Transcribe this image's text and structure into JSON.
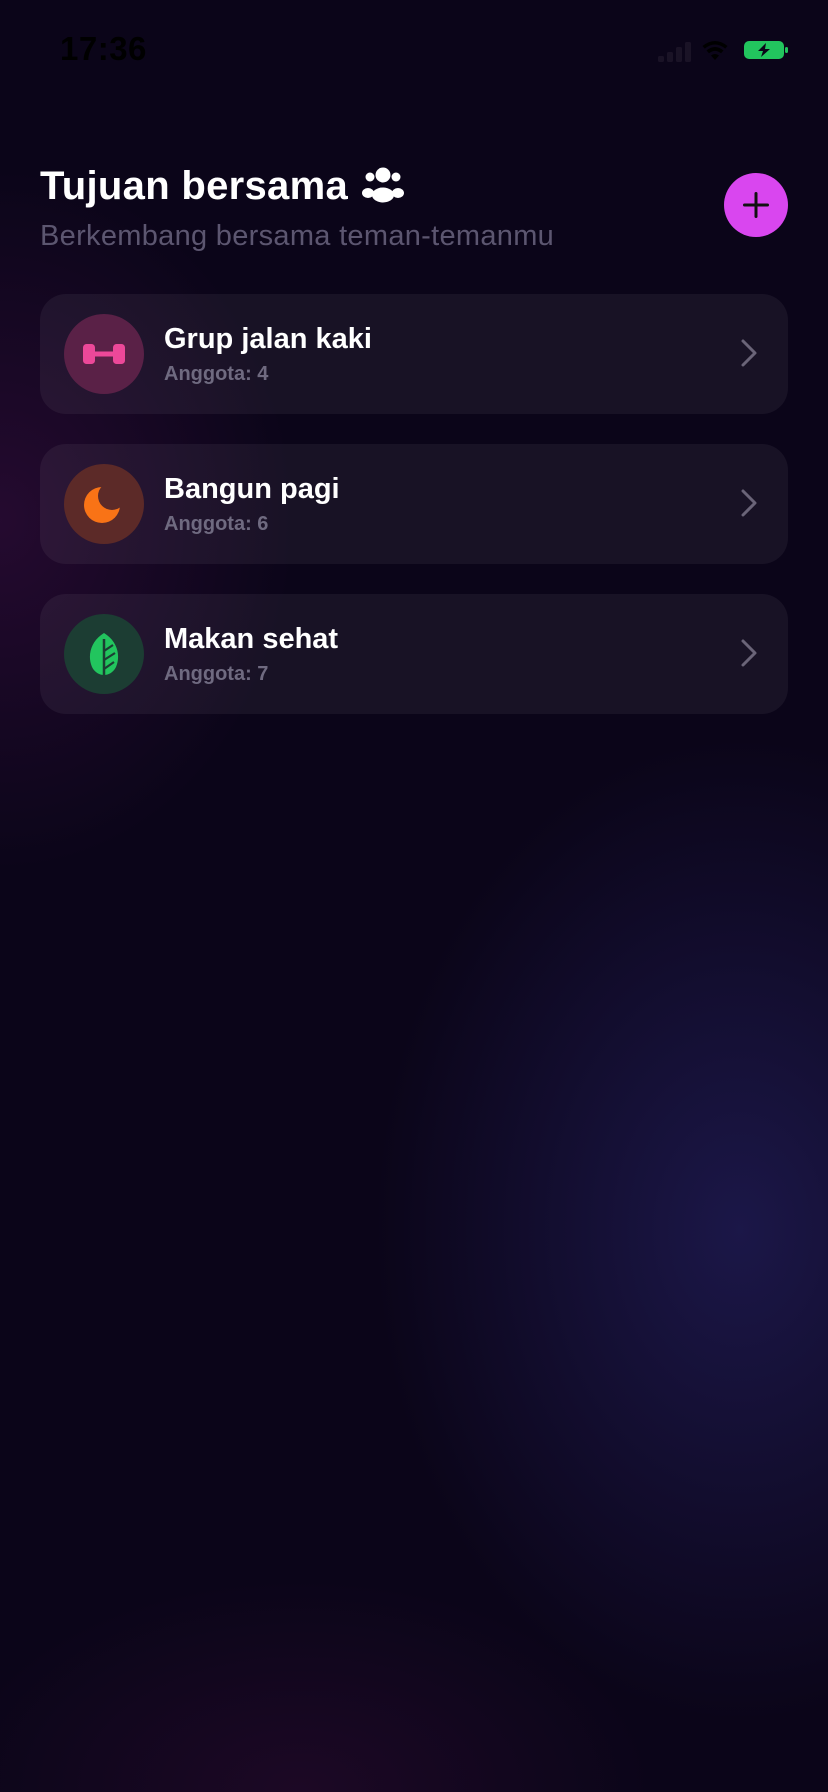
{
  "status_bar": {
    "time": "17:36"
  },
  "header": {
    "title": "Tujuan bersama",
    "title_icon": "people-group-icon",
    "subtitle": "Berkembang bersama teman-temanmu",
    "add_icon": "plus-icon"
  },
  "groups": [
    {
      "name": "Grup jalan kaki",
      "members": "Anggota: 4",
      "icon": "dumbbell-icon",
      "icon_color": "#ec4899",
      "icon_bg": "#5a2147"
    },
    {
      "name": "Bangun pagi",
      "members": "Anggota: 6",
      "icon": "moon-icon",
      "icon_color": "#f97316",
      "icon_bg": "#5c2a28"
    },
    {
      "name": "Makan sehat",
      "members": "Anggota: 7",
      "icon": "leaf-icon",
      "icon_color": "#22c55e",
      "icon_bg": "#1c3d33"
    }
  ],
  "colors": {
    "accent": "#d946ef",
    "background": "#0b0519",
    "battery": "#22c55e"
  }
}
